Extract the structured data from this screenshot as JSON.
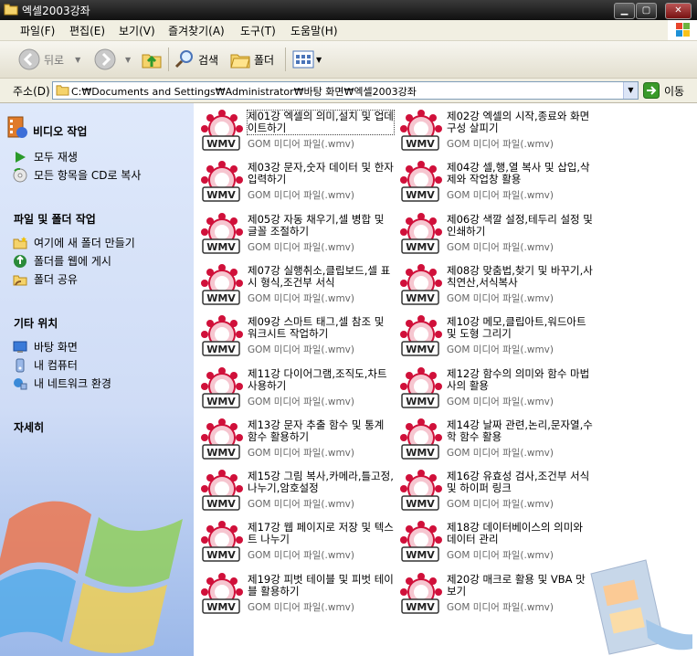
{
  "window": {
    "title": "엑셀2003강좌"
  },
  "menu": [
    "파일(F)",
    "편집(E)",
    "보기(V)",
    "즐겨찾기(A)",
    "도구(T)",
    "도움말(H)"
  ],
  "toolbar": {
    "back": "뒤로",
    "search": "검색",
    "folders": "폴더"
  },
  "address": {
    "label": "주소(D)",
    "path": "C:₩Documents and Settings₩Administrator₩바탕 화면₩엑셀2003강좌",
    "go": "이동"
  },
  "tasks": {
    "video": {
      "title": "비디오 작업",
      "items": [
        "모두 재생",
        "모든 항목을 CD로 복사"
      ]
    },
    "file": {
      "title": "파일 및 폴더 작업",
      "items": [
        "여기에 새 폴더 만들기",
        "폴더를 웹에 게시",
        "폴더 공유"
      ]
    },
    "other": {
      "title": "기타 위치",
      "items": [
        "바탕 화면",
        "내 컴퓨터",
        "내 네트워크 환경"
      ]
    },
    "details": {
      "title": "자세히"
    }
  },
  "files": [
    {
      "name": "제01강 엑셀의 의미,설치 및 업데이트하기",
      "type": "GOM 미디어 파일(.wmv)"
    },
    {
      "name": "제02강 엑셀의 시작,종료와 화면구성 살피기",
      "type": "GOM 미디어 파일(.wmv)"
    },
    {
      "name": "제03강 문자,숫자 데이터 및 한자 입력하기",
      "type": "GOM 미디어 파일(.wmv)"
    },
    {
      "name": "제04강 셀,행,열 복사 및 삽입,삭제와 작업창 활용",
      "type": "GOM 미디어 파일(.wmv)"
    },
    {
      "name": "제05강 자동 채우기,셀 병합 및 글꼴 조절하기",
      "type": "GOM 미디어 파일(.wmv)"
    },
    {
      "name": "제06강 색깔 설정,테두리 설정 및 인쇄하기",
      "type": "GOM 미디어 파일(.wmv)"
    },
    {
      "name": "제07강 실행취소,클립보드,셀 표시 형식,조건부 서식",
      "type": "GOM 미디어 파일(.wmv)"
    },
    {
      "name": "제08강 맞춤법,찾기 및 바꾸기,사칙연산,서식복사",
      "type": "GOM 미디어 파일(.wmv)"
    },
    {
      "name": "제09강 스마트 태그,셀 참조 및 워크시트 작업하기",
      "type": "GOM 미디어 파일(.wmv)"
    },
    {
      "name": "제10강 메모,클립아트,워드아트 및 도형 그리기",
      "type": "GOM 미디어 파일(.wmv)"
    },
    {
      "name": "제11강 다이어그램,조직도,차트 사용하기",
      "type": "GOM 미디어 파일(.wmv)"
    },
    {
      "name": "제12강 함수의 의미와 함수 마법사의 활용",
      "type": "GOM 미디어 파일(.wmv)"
    },
    {
      "name": "제13강 문자 추출 함수 및 통계 함수 활용하기",
      "type": "GOM 미디어 파일(.wmv)"
    },
    {
      "name": "제14강 날짜 관련,논리,문자열,수학 함수 활용",
      "type": "GOM 미디어 파일(.wmv)"
    },
    {
      "name": "제15강 그림 복사,카메라,틀고정,나누기,암호설정",
      "type": "GOM 미디어 파일(.wmv)"
    },
    {
      "name": "제16강 유효성 검사,조건부 서식 및 하이퍼 링크",
      "type": "GOM 미디어 파일(.wmv)"
    },
    {
      "name": "제17강 웹 페이지로 저장 및 텍스트 나누기",
      "type": "GOM 미디어 파일(.wmv)"
    },
    {
      "name": "제18강 데이터베이스의 의미와 데이터 관리",
      "type": "GOM 미디어 파일(.wmv)"
    },
    {
      "name": "제19강 피벗 테이블 및 피벗 테이블 활용하기",
      "type": "GOM 미디어 파일(.wmv)"
    },
    {
      "name": "제20강 매크로 활용 및 VBA 맛보기",
      "type": "GOM 미디어 파일(.wmv)"
    }
  ],
  "icons": {
    "file": "wmv-icon",
    "iconText": "WMV",
    "accent": "#d0103a"
  }
}
